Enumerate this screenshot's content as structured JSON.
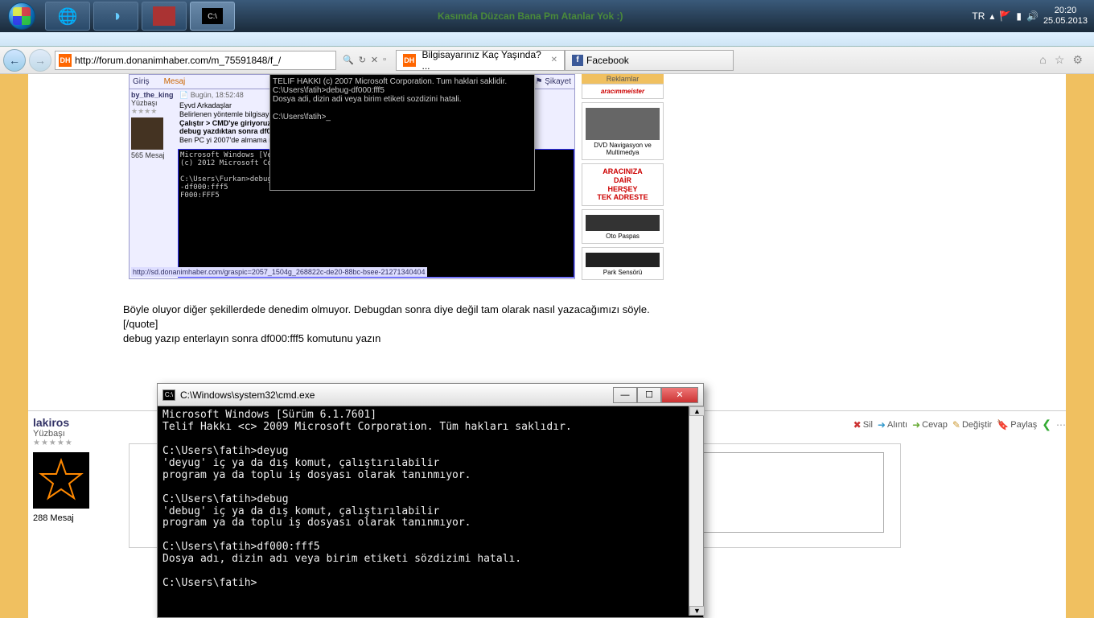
{
  "taskbar": {
    "game_title": "Kasımda Düzcan Bana Pm Atanlar Yok :)",
    "tray_lang": "TR",
    "time": "20:20",
    "date": "25.05.2013"
  },
  "browser": {
    "url": "http://forum.donanimhaber.com/m_75591848/f_/",
    "tab1": "Bilgisayarınız Kaç Yaşında? ...",
    "tab2": "Facebook"
  },
  "post1": {
    "tab_entry": "Giriş",
    "tab_msg": "Mesaj",
    "user": "by_the_king",
    "rank": "Yüzbaşı",
    "msgs": "565 Mesaj",
    "date": "Bugün, 18:52:48",
    "greet": "Eyvd Arkadaşlar",
    "line1": "Belirlenen yöntemle bilgisayarımızın",
    "line2": "Çalıştır > CMD'ye giriyoruz.",
    "line3": "debug yazdıktan sonra df000:fff5",
    "line4": "Ben PC yi 2007'de almama rağmen",
    "report": "⚑ Şikayet",
    "link_text": "http://sd.donanimhaber.com/graspic=2057_1504g_268822c-de20-88bc-bsee-21271340404"
  },
  "ad": {
    "header": "Reklamlar",
    "brand": "aracımmeister",
    "caption1": "DVD Navigasyon ve Multimedya",
    "red": "ARACINIZA\nDAİR\nHERŞEY\nTEK ADRESTE",
    "caption2": "Oto Paspas",
    "caption3": "Park Sensörü"
  },
  "cmd1": {
    "l1": "TELIF HAKKI (c) 2007 Microsoft Corporation. Tum haklari saklidir.",
    "l2": "C:\\Users\\fatih>debug-df000:fff5",
    "l3": "Dosya adi, dizin adi veya birim etiketi sozdizini hatali.",
    "l4": "C:\\Users\\fatih>_"
  },
  "reply": {
    "l1": "Böyle oluyor diğer şekillerdede denedim olmuyor. Debugdan sonra diye değil tam olarak nasıl yazacağımızı söyle.",
    "l2": "[/quote]",
    "l3": "debug yazıp enterlayın sonra df000:fff5 komutunu yazın"
  },
  "post2": {
    "name": "lakiros",
    "rank": "Yüzbaşı",
    "msgs": "288 Mesaj"
  },
  "actions": {
    "sil": "Sil",
    "alinti": "Alıntı",
    "cevap": "Cevap",
    "degistir": "Değiştir",
    "paylas": "Paylaş"
  },
  "bigcmd": {
    "title": "C:\\Windows\\system32\\cmd.exe",
    "body": "Microsoft Windows [Sürüm 6.1.7601]\nTelif Hakkı <c> 2009 Microsoft Corporation. Tüm hakları saklıdır.\n\nC:\\Users\\fatih>deyug\n'deyug' iç ya da dış komut, çalıştırılabilir\nprogram ya da toplu iş dosyası olarak tanınmıyor.\n\nC:\\Users\\fatih>debug\n'debug' iç ya da dış komut, çalıştırılabilir\nprogram ya da toplu iş dosyası olarak tanınmıyor.\n\nC:\\Users\\fatih>df000:fff5\nDosya adı, dizin adı veya birim etiketi sözdizimi hatalı.\n\nC:\\Users\\fatih>"
  }
}
